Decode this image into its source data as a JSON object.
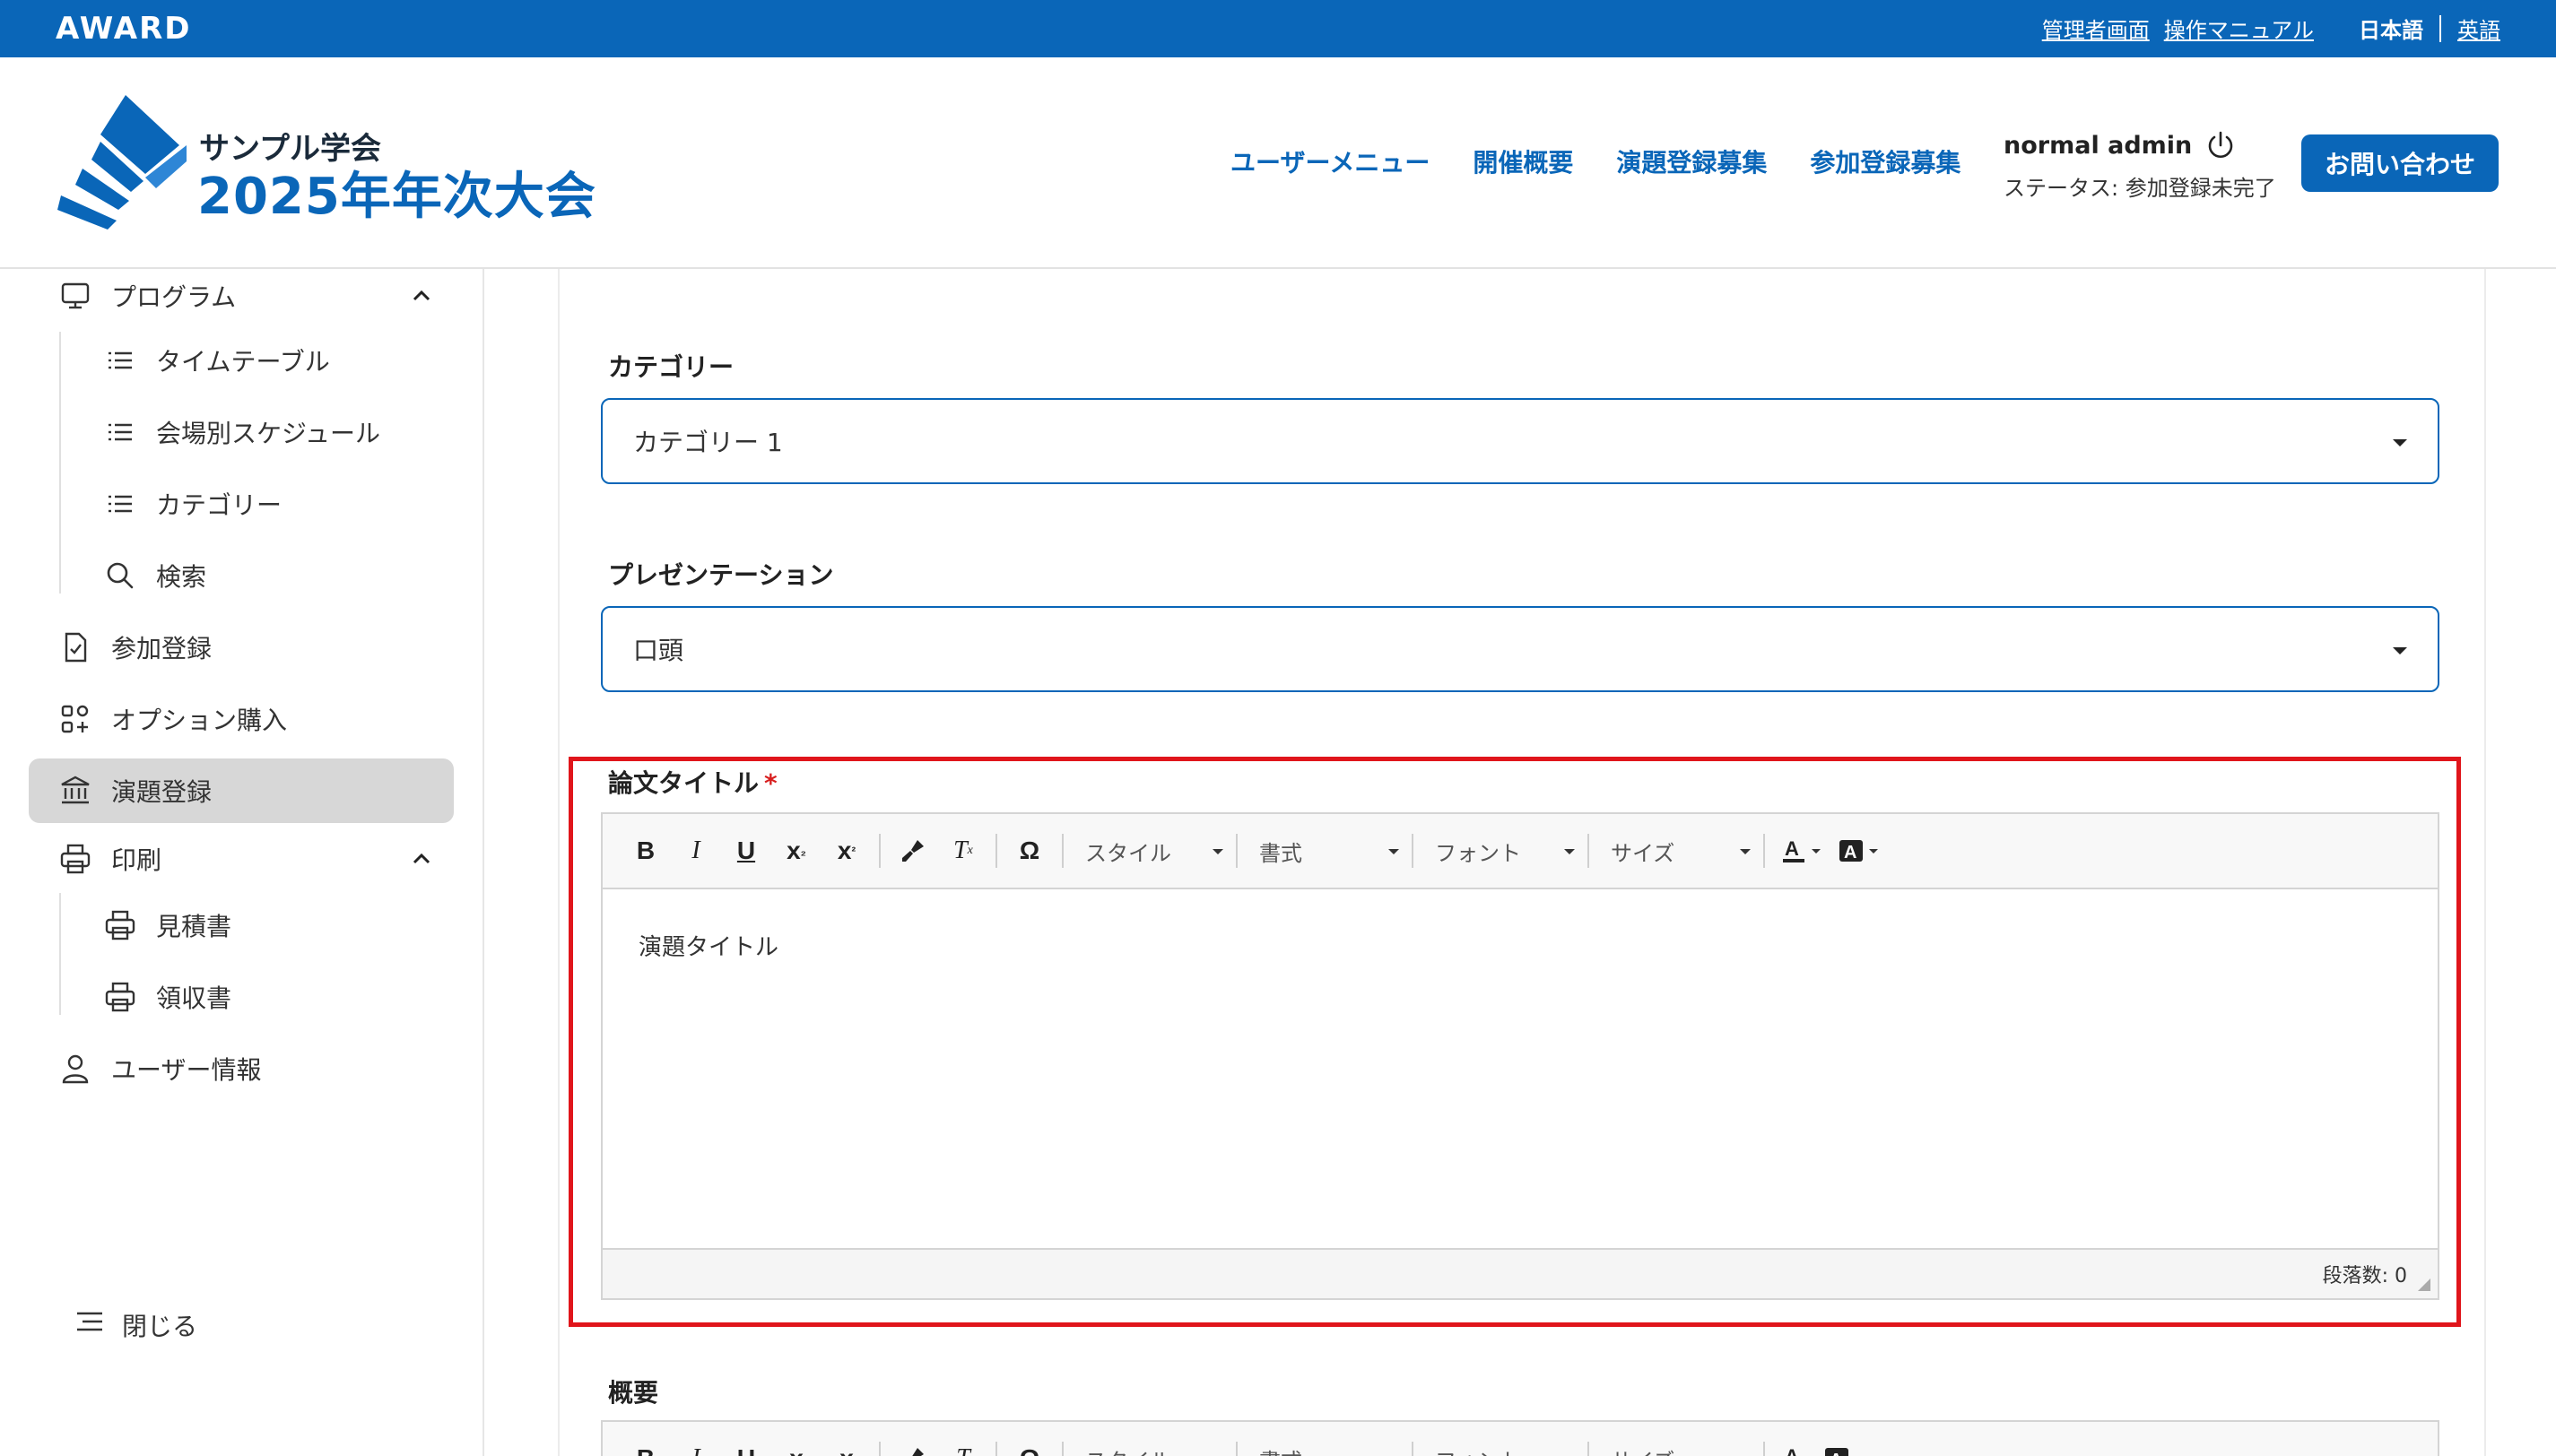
{
  "topbar": {
    "brand": "AWARD",
    "admin_link": "管理者画面",
    "manual_link": "操作マニュアル",
    "lang_ja": "日本語",
    "lang_en": "英語"
  },
  "header": {
    "logo_sub": "サンプル学会",
    "logo_main": "2025年年次大会",
    "nav": [
      "ユーザーメニュー",
      "開催概要",
      "演題登録募集",
      "参加登録募集"
    ],
    "user_name": "normal admin",
    "user_status": "ステータス: 参加登録未完了",
    "contact_button": "お問い合わせ"
  },
  "sidebar": {
    "program": "プログラム",
    "timetable": "タイムテーブル",
    "venue_schedule": "会場別スケジュール",
    "category": "カテゴリー",
    "search": "検索",
    "registration": "参加登録",
    "option_purchase": "オプション購入",
    "abstract_registration": "演題登録",
    "print": "印刷",
    "estimate": "見積書",
    "receipt": "領収書",
    "user_info": "ユーザー情報",
    "close": "閉じる"
  },
  "form": {
    "category_label": "カテゴリー",
    "category_value": "カテゴリー 1",
    "presentation_label": "プレゼンテーション",
    "presentation_value": "口頭",
    "title_label": "論文タイトル",
    "required_mark": "*",
    "title_content": "演題タイトル",
    "paragraph_count": "段落数: 0",
    "summary_label": "概要"
  },
  "editor_toolbar": {
    "style": "スタイル",
    "format": "書式",
    "font": "フォント",
    "size": "サイズ"
  },
  "colors": {
    "brand_blue": "#0a66b8",
    "highlight_red": "#e0151b"
  }
}
